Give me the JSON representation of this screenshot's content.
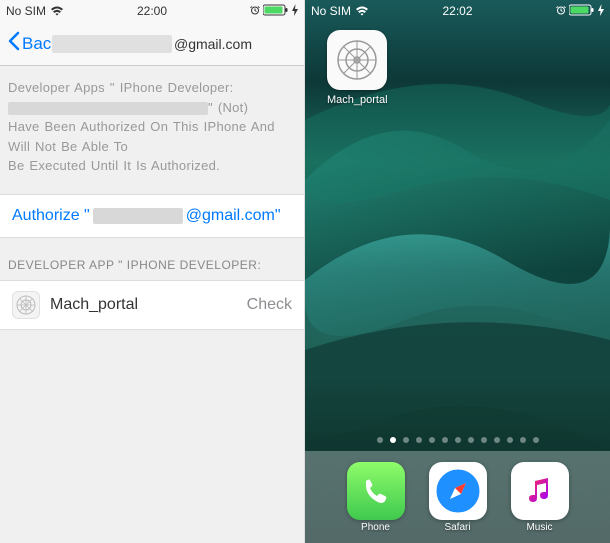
{
  "left": {
    "status": {
      "carrier": "No SIM",
      "time": "22:00"
    },
    "nav": {
      "back": "Back",
      "title_suffix": "@gmail.com"
    },
    "info": {
      "line1": "Developer Apps \" IPhone Developer:",
      "line2_suffix": "\" (Not)",
      "line3": "Have Been Authorized On This IPhone And Will Not Be Able To",
      "line4": "Be Executed Until It Is Authorized."
    },
    "authorize": {
      "prefix": "Authorize \"",
      "suffix": "@gmail.com\""
    },
    "section_header": "DEVELOPER APP \" IPHONE DEVELOPER:",
    "app": {
      "name": "Mach_portal",
      "status": "Check"
    }
  },
  "right": {
    "status": {
      "carrier": "No SIM",
      "time": "22:02"
    },
    "home_app": {
      "label": "Mach_portal"
    },
    "dock": {
      "phone": "Phone",
      "safari": "Safari",
      "music": "Music"
    }
  }
}
